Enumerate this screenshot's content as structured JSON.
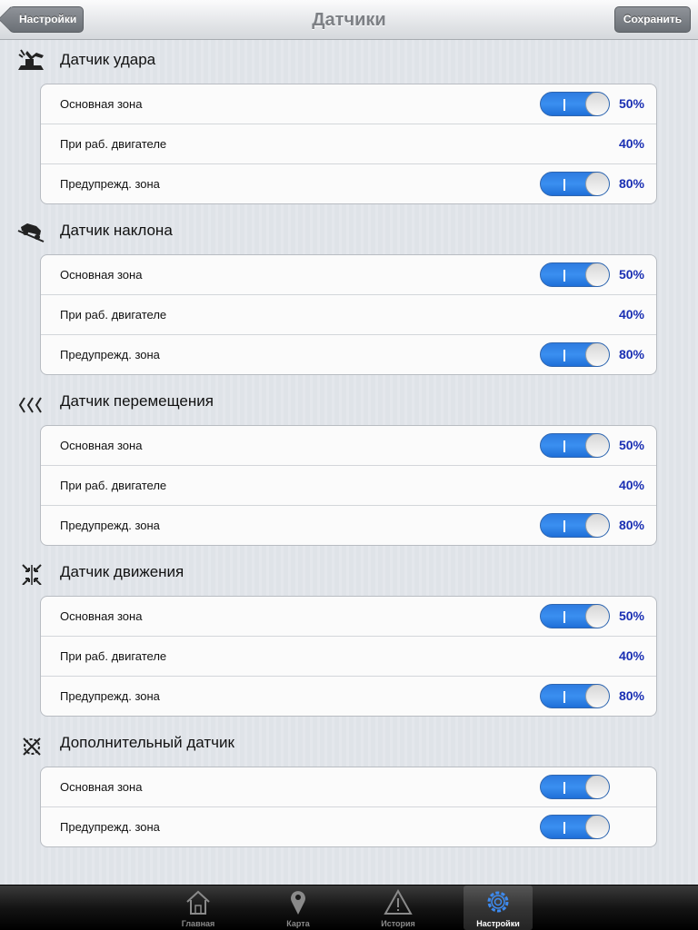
{
  "nav": {
    "back_label": "Настройки",
    "title": "Датчики",
    "save_label": "Сохранить"
  },
  "sections": [
    {
      "title": "Датчик удара",
      "icon": "impact-sensor-icon",
      "rows": [
        {
          "label": "Основная зона",
          "switch": true,
          "switch_on": true,
          "value": "50%"
        },
        {
          "label": "При раб. двигателе",
          "switch": false,
          "value": "40%"
        },
        {
          "label": "Предупрежд. зона",
          "switch": true,
          "switch_on": true,
          "value": "80%"
        }
      ]
    },
    {
      "title": "Датчик наклона",
      "icon": "tilt-sensor-icon",
      "rows": [
        {
          "label": "Основная зона",
          "switch": true,
          "switch_on": true,
          "value": "50%"
        },
        {
          "label": "При раб. двигателе",
          "switch": false,
          "value": "40%"
        },
        {
          "label": "Предупрежд. зона",
          "switch": true,
          "switch_on": true,
          "value": "80%"
        }
      ]
    },
    {
      "title": "Датчик перемещения",
      "icon": "displacement-sensor-icon",
      "rows": [
        {
          "label": "Основная зона",
          "switch": true,
          "switch_on": true,
          "value": "50%"
        },
        {
          "label": "При раб. двигателе",
          "switch": false,
          "value": "40%"
        },
        {
          "label": "Предупрежд. зона",
          "switch": true,
          "switch_on": true,
          "value": "80%"
        }
      ]
    },
    {
      "title": "Датчик движения",
      "icon": "motion-sensor-icon",
      "rows": [
        {
          "label": "Основная зона",
          "switch": true,
          "switch_on": true,
          "value": "50%"
        },
        {
          "label": "При раб. двигателе",
          "switch": false,
          "value": "40%"
        },
        {
          "label": "Предупрежд. зона",
          "switch": true,
          "switch_on": true,
          "value": "80%"
        }
      ]
    },
    {
      "title": "Дополнительный датчик",
      "icon": "additional-sensor-icon",
      "rows": [
        {
          "label": "Основная зона",
          "switch": true,
          "switch_on": true,
          "value": ""
        },
        {
          "label": "Предупрежд. зона",
          "switch": true,
          "switch_on": true,
          "value": ""
        }
      ]
    }
  ],
  "tabs": [
    {
      "label": "Главная",
      "icon": "home-icon",
      "active": false
    },
    {
      "label": "Карта",
      "icon": "map-pin-icon",
      "active": false
    },
    {
      "label": "История",
      "icon": "warning-icon",
      "active": false
    },
    {
      "label": "Настройки",
      "icon": "gear-icon",
      "active": true
    }
  ],
  "colors": {
    "value_text": "#1a2fb3",
    "switch_on": "#2d7be0"
  }
}
